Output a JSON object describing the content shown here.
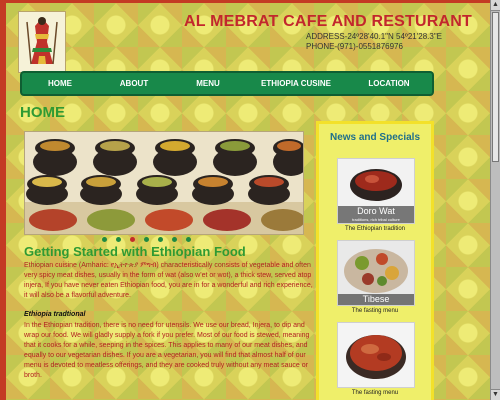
{
  "header": {
    "title": "AL MEBRAT CAFE AND RESTURANT",
    "address": "ADDRESS-24º28'40.1\"N 54º21'28.3\"E",
    "phone": "PHONE-(971)-0551876976"
  },
  "nav": {
    "items": [
      {
        "label": "HOME"
      },
      {
        "label": "ABOUT"
      },
      {
        "label": "MENU"
      },
      {
        "label": "ETHIOPIA CUSINE"
      },
      {
        "label": "LOCATION"
      }
    ]
  },
  "main": {
    "heading": "HOME",
    "slider": {
      "dot_count": 7,
      "active_index": 2
    },
    "article_heading": "Getting Started with Ethiopian Food",
    "intro": "Ethiopian cuisine (Amharic: የኢትዮጵያ ምግብ) characteristically consists of vegetable and often very spicy meat dishes, usually in the form of wat (also w'et or wot), a thick stew, served atop injera, If you have never eaten Ethiopian food, you are in for a wonderful and rich experience, it will also be a flavorful adventure.",
    "subheading": "Ethiopia tradtional",
    "body": "In the Ethiopian tradition, there is no need for utensils. We use our bread, Injera, to dip and wrap our food. We will gladly supply a fork if you prefer. Most of our food is stewed, meaning that it cooks for a while, seeping in the spices. This applies to many of our meat dishes, and equally to our vegetarian dishes. If you are a vegetarian, you will find that almost half of our menu is devoted to meatless offerings, and they are cooked truly without any meat sauce or broth."
  },
  "sidebar": {
    "heading": "News and Specials",
    "cards": [
      {
        "caption_title": "Doro Wat",
        "caption_sub": "traditions, rich tribal culture",
        "label": "The Ethiopian tradition"
      },
      {
        "caption_title": "Tibese",
        "caption_sub": "",
        "label": "The fasting menu"
      },
      {
        "caption_title": "",
        "caption_sub": "",
        "label": "The fasting menu"
      }
    ]
  },
  "colors": {
    "title_red": "#c2272d",
    "nav_green": "#18894a",
    "heading_green": "#2f9a33",
    "text_red": "#b22222",
    "sidebar_bg": "#efef6a",
    "sidebar_heading": "#1f6f8b"
  }
}
